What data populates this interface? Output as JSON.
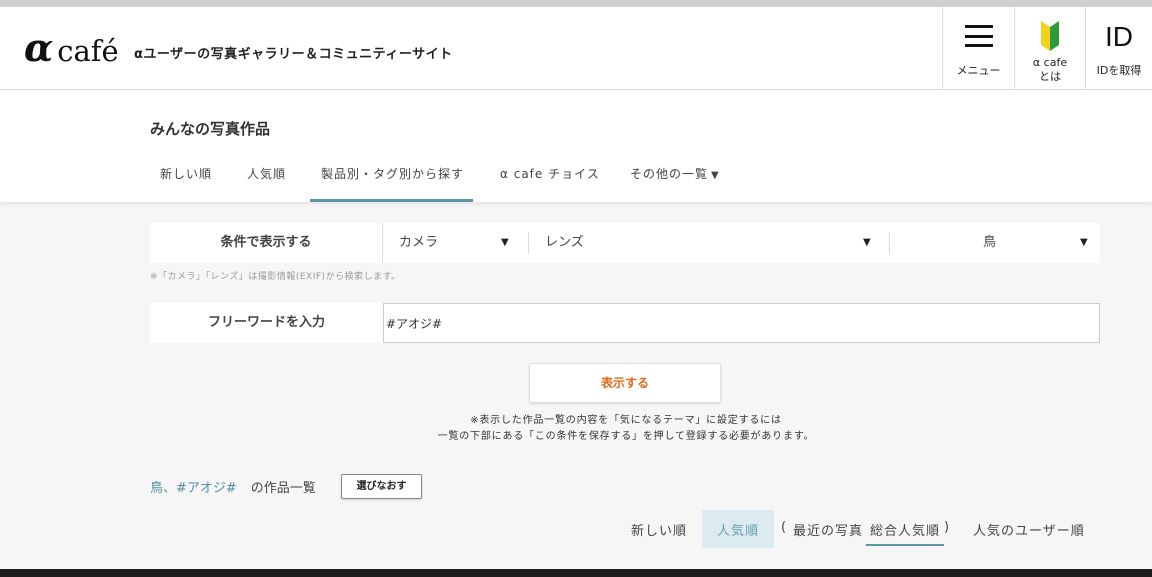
{
  "header": {
    "logo_alpha": "α",
    "logo_cafe": "café",
    "tagline": "αユーザーの写真ギャラリー＆コミュニティーサイト",
    "menu_label": "メニュー",
    "about_label_line1": "α cafe",
    "about_label_line2": "とは",
    "id_big": "ID",
    "id_label": "IDを取得"
  },
  "page": {
    "title": "みんなの写真作品"
  },
  "tabs": [
    {
      "label": "新しい順"
    },
    {
      "label": "人気順"
    },
    {
      "label": "製品別・タグ別から探す",
      "active": true
    },
    {
      "label": "α cafe チョイス"
    },
    {
      "label": "その他の一覧"
    }
  ],
  "tab_more_arrow": "▼",
  "filters": {
    "label": "条件で表示する",
    "camera": "カメラ",
    "lens": "レンズ",
    "subject": "鳥",
    "arrow": "▼",
    "note": "※「カメラ」「レンズ」は撮影情報(EXIF)から検索します。"
  },
  "keyword": {
    "label": "フリーワードを入力",
    "value": "#アオジ#"
  },
  "show_button": "表示する",
  "notice": {
    "line1": "※表示した作品一覧の内容を「気になるテーマ」に設定するには",
    "line2": "一覧の下部にある「この条件を保存する」を押して登録する必要があります。"
  },
  "result": {
    "tags": "鳥、#アオジ#",
    "suffix": "の作品一覧",
    "reselect": "選びなおす"
  },
  "sort": {
    "newest": "新しい順",
    "popular": "人気順",
    "open_paren": "(",
    "recent": "最近の写真",
    "overall": "総合人気順",
    "close_paren": ")",
    "users": "人気のユーザー順"
  },
  "colors": {
    "accent": "#5b95a8",
    "button_text": "#e06a1a",
    "active_sort_bg": "#dcebf0"
  }
}
